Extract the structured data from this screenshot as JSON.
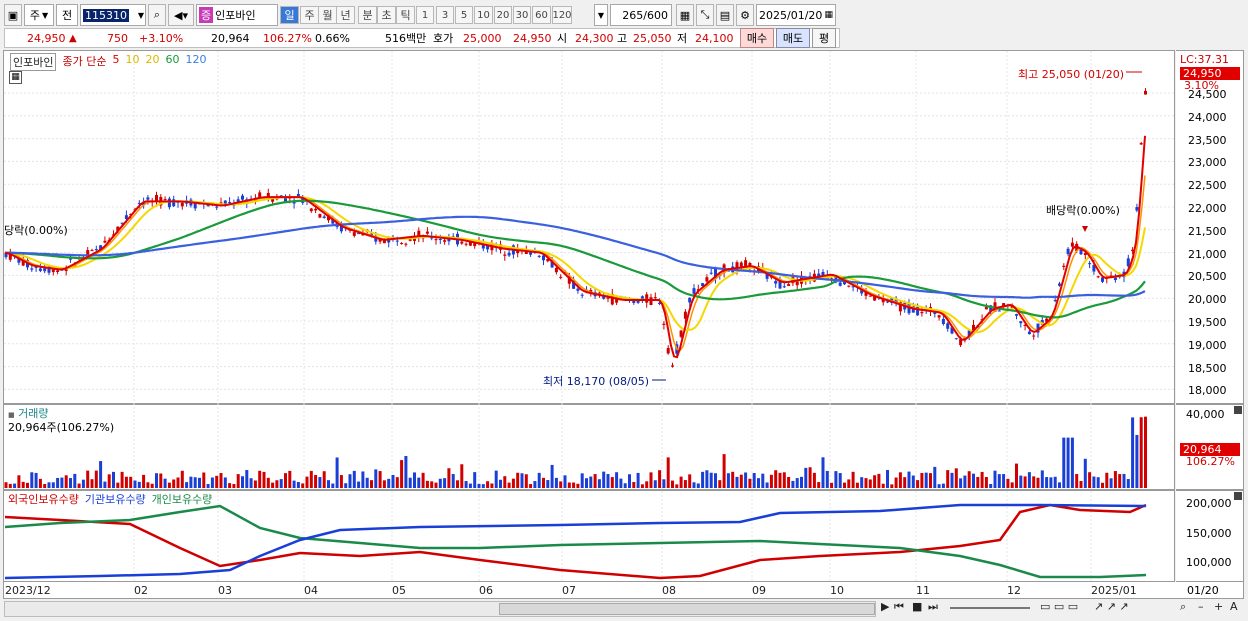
{
  "toolbar": {
    "period_main": "주",
    "prev_label": "전",
    "code": "115310",
    "stock_name": "인포바인",
    "stock_badge": "증",
    "periods": [
      "일",
      "주",
      "월",
      "년",
      "분",
      "초",
      "틱"
    ],
    "minutes": [
      "1",
      "3",
      "5",
      "10",
      "20",
      "30",
      "60",
      "120"
    ],
    "count": "265",
    "count_max": "/600",
    "date": "2025/01/20"
  },
  "quote": {
    "price": "24,950",
    "up_arrow": "▲",
    "change": "750",
    "change_pct": "+3.10%",
    "volume": "20,964",
    "volume_ratio": "106.27%",
    "turnover": "0.66%",
    "amount": "516백만",
    "ask_label": "호가",
    "ask": "25,000",
    "bid": "24,950",
    "open_label": "시",
    "open": "24,300",
    "high_label": "고",
    "high": "25,050",
    "low_label": "저",
    "low": "24,100",
    "buy": "매수",
    "sell": "매도",
    "avg": "평"
  },
  "price_panel": {
    "name": "인포바인",
    "ma_label": "종가 단순",
    "ma_periods": [
      "5",
      "10",
      "20",
      "60",
      "120"
    ],
    "lc": "LC:37.31",
    "last_price": "24,950",
    "last_pct": "3.10%",
    "high_note": "최고 25,050 (01/20)",
    "low_note": "최저 18,170 (08/05)",
    "div_note_right": "배당락(0.00%)",
    "div_note_left": "당락(0.00%)",
    "y_ticks": [
      "24,500",
      "24,000",
      "23,500",
      "23,000",
      "22,500",
      "22,000",
      "21,500",
      "21,000",
      "20,500",
      "20,000",
      "19,500",
      "19,000",
      "18,500",
      "18,000"
    ]
  },
  "volume_panel": {
    "title": "거래량",
    "value": "20,964주(106.27%)",
    "y_ticks": [
      "40,000",
      "20,000"
    ],
    "last_value": "20,964",
    "last_pct": "106.27%"
  },
  "holding_panel": {
    "legend": [
      "외국인보유수량",
      "기관보유수량",
      "개인보유수량"
    ],
    "y_ticks": [
      "200,000",
      "150,000",
      "100,000"
    ]
  },
  "x_axis": {
    "labels": [
      "2023/12",
      "02",
      "03",
      "04",
      "05",
      "06",
      "07",
      "08",
      "09",
      "10",
      "11",
      "12",
      "2025/01"
    ],
    "last": "01/20"
  },
  "colors": {
    "up": "#d00000",
    "down": "#1a3fd6",
    "ma5": "#e00000",
    "ma10": "#ff9000",
    "ma20": "#f5d800",
    "ma60": "#1a9a3a",
    "ma120": "#3a60e0"
  }
}
